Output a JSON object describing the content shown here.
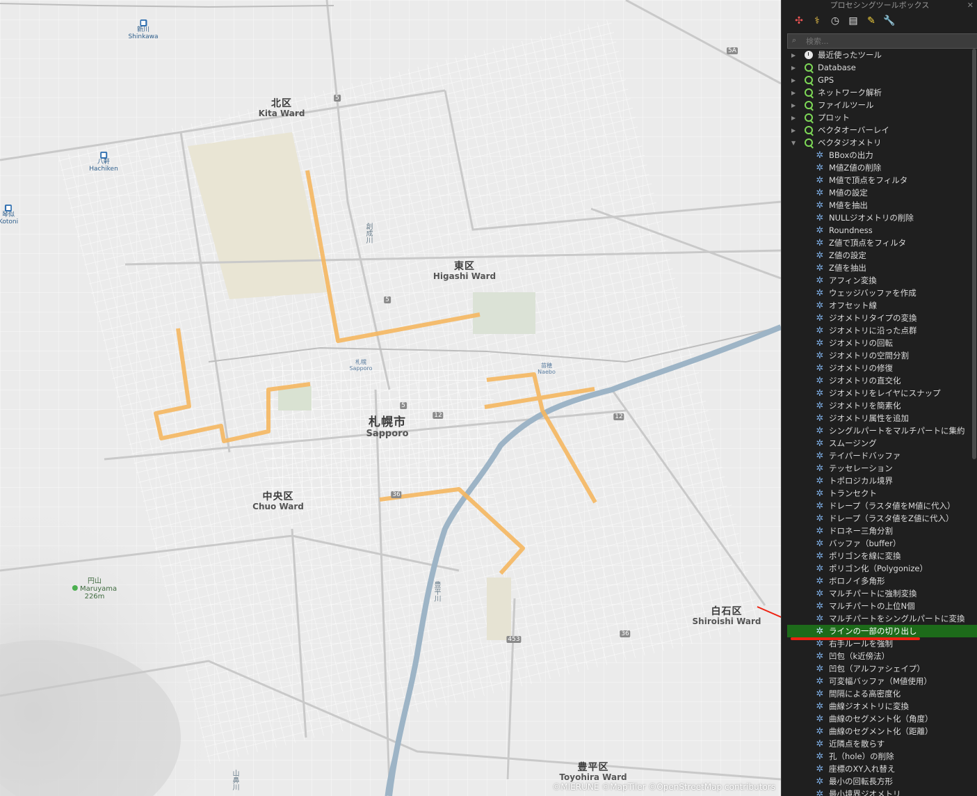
{
  "map": {
    "wards": [
      {
        "ja": "北区",
        "en": "Kita Ward"
      },
      {
        "ja": "東区",
        "en": "Higashi Ward"
      },
      {
        "ja": "中央区",
        "en": "Chuo Ward"
      },
      {
        "ja": "白石区",
        "en": "Shiroishi Ward"
      },
      {
        "ja": "豊平区",
        "en": "Toyohira Ward"
      }
    ],
    "city": {
      "ja": "札幌市",
      "en": "Sapporo"
    },
    "stations": [
      {
        "ja": "新川",
        "en": "Shinkawa"
      },
      {
        "ja": "八軒",
        "en": "Hachiken"
      },
      {
        "ja": "琴似",
        "en": "Kotoni"
      }
    ],
    "small_stations": [
      {
        "ja": "札幌",
        "en": "Sapporo"
      },
      {
        "ja": "苗穂",
        "en": "Naebo"
      }
    ],
    "mountain": {
      "ja": "円山",
      "en": "Maruyama",
      "elev": "226m"
    },
    "road_shields": [
      "5",
      "5",
      "5",
      "12",
      "12",
      "36",
      "36",
      "453",
      "5A"
    ],
    "rivers": [
      "創成川",
      "豊平川",
      "山鼻川"
    ],
    "attribution": "©MIERUNE ©MapTiler ©OpenStreetMap contributors",
    "colors": {
      "route": "#f5b760",
      "background": "#ebebeb",
      "river": "#9db4c6"
    }
  },
  "panel": {
    "title": "プロセシングツールボックス",
    "close": "✕",
    "search_placeholder": "検索...",
    "toolbar_icons": [
      "models-icon",
      "python-icon",
      "history-icon",
      "results-icon",
      "edit-icon",
      "options-icon"
    ],
    "groups": [
      {
        "label": "最近使ったツール",
        "icon": "clock-icon",
        "expanded": false
      },
      {
        "label": "Database",
        "icon": "qgis-icon",
        "expanded": false
      },
      {
        "label": "GPS",
        "icon": "qgis-icon",
        "expanded": false
      },
      {
        "label": "ネットワーク解析",
        "icon": "qgis-icon",
        "expanded": false
      },
      {
        "label": "ファイルツール",
        "icon": "qgis-icon",
        "expanded": false
      },
      {
        "label": "プロット",
        "icon": "qgis-icon",
        "expanded": false
      },
      {
        "label": "ベクタオーバーレイ",
        "icon": "qgis-icon",
        "expanded": false
      },
      {
        "label": "ベクタジオメトリ",
        "icon": "qgis-icon",
        "expanded": true
      }
    ],
    "tools": [
      "BBoxの出力",
      "M値Z値の削除",
      "M値で頂点をフィルタ",
      "M値の設定",
      "M値を抽出",
      "NULLジオメトリの削除",
      "Roundness",
      "Z値で頂点をフィルタ",
      "Z値の設定",
      "Z値を抽出",
      "アフィン変換",
      "ウェッジバッファを作成",
      "オフセット線",
      "ジオメトリタイプの変換",
      "ジオメトリに沿った点群",
      "ジオメトリの回転",
      "ジオメトリの空間分割",
      "ジオメトリの修復",
      "ジオメトリの直交化",
      "ジオメトリをレイヤにスナップ",
      "ジオメトリを簡素化",
      "ジオメトリ属性を追加",
      "シングルパートをマルチパートに集約",
      "スムージング",
      "テイパードバッファ",
      "テッセレーション",
      "トポロジカル境界",
      "トランセクト",
      "ドレープ（ラスタ値をM値に代入）",
      "ドレープ（ラスタ値をZ値に代入）",
      "ドロネー三角分割",
      "バッファ（buffer）",
      "ポリゴンを線に変換",
      "ポリゴン化（Polygonize）",
      "ボロノイ多角形",
      "マルチパートに強制変換",
      "マルチパートの上位N個",
      "マルチパートをシングルパートに変換",
      "ラインの一部の切り出し",
      "右手ルールを強制",
      "凹包（k近傍法）",
      "凹包（アルファシェイプ）",
      "可変幅バッファ（M値使用）",
      "間隔による高密度化",
      "曲線ジオメトリに変換",
      "曲線のセグメント化（角度）",
      "曲線のセグメント化（距離）",
      "近隣点を散らす",
      "孔（hole）の削除",
      "座標のXY入れ替え",
      "最小の回転長方形",
      "最小境界ジオメトリ"
    ],
    "selected_tool_index": 38,
    "selection_color": "#1d6b1a"
  }
}
